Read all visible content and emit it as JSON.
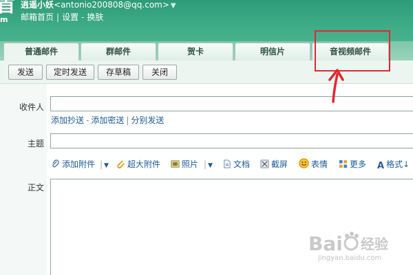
{
  "header": {
    "logo_fragment": "首",
    "logo_sub": "m",
    "user_name": "逍遥小妖",
    "user_email": "<antonio200808@qq.com>",
    "nav": [
      "邮箱首页",
      "设置",
      "换肤"
    ],
    "nav_sep1": "|",
    "nav_sep2": "-"
  },
  "tabs": [
    {
      "label": "普通邮件"
    },
    {
      "label": "群邮件"
    },
    {
      "label": "贺卡"
    },
    {
      "label": "明信片"
    },
    {
      "label": "音视频邮件"
    }
  ],
  "toolbar": {
    "send": "发送",
    "scheduled_send": "定时发送",
    "save_draft": "存草稿",
    "close": "关闭"
  },
  "compose": {
    "to_label": "收件人",
    "add_cc": "添加抄送",
    "link_sep1": "-",
    "add_bcc": "添加密送",
    "link_sep2": "|",
    "separate_send": "分别发送",
    "subject_label": "主题",
    "body_label": "正文"
  },
  "attachments": {
    "add_attachment": "添加附件",
    "big_attachment": "超大附件",
    "photo": "照片",
    "document": "文档",
    "screenshot": "截屏",
    "emoticon": "表情",
    "more": "更多",
    "format": "格式",
    "format_tail": "↓"
  },
  "watermark": {
    "brand": "Bai",
    "brand_cn": "经验",
    "url": "jingyan.baidu.com"
  },
  "colors": {
    "header_green": "#3aa783",
    "annotation_red": "#e3272b",
    "link_blue": "#1d5a96"
  }
}
